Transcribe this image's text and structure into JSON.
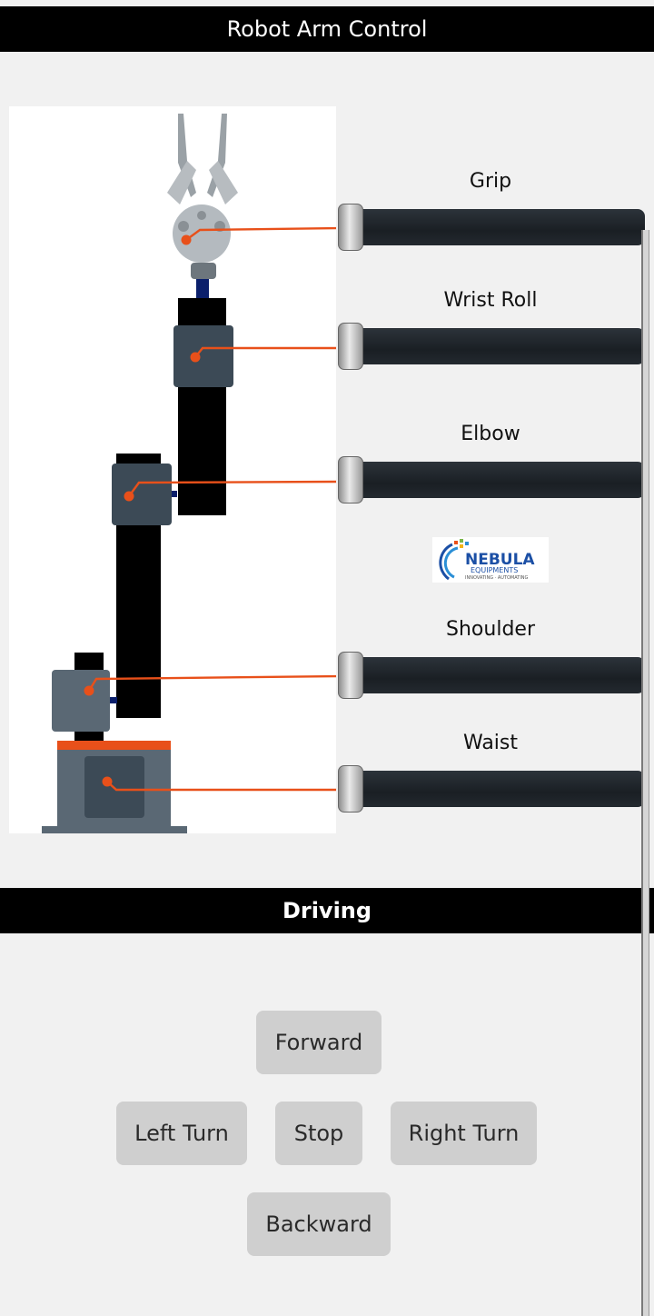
{
  "header": {
    "title": "Robot Arm Control"
  },
  "sliders": [
    {
      "id": "grip",
      "label": "Grip",
      "value": 0
    },
    {
      "id": "wrist-roll",
      "label": "Wrist Roll",
      "value": 0
    },
    {
      "id": "elbow",
      "label": "Elbow",
      "value": 0
    },
    {
      "id": "shoulder",
      "label": "Shoulder",
      "value": 0
    },
    {
      "id": "waist",
      "label": "Waist",
      "value": 0
    }
  ],
  "logo": {
    "name": "NEBULA",
    "sub": "EQUIPMENTS",
    "tagline": "INNOVATING · AUTOMATING"
  },
  "driving": {
    "title": "Driving",
    "forward": "Forward",
    "left": "Left Turn",
    "stop": "Stop",
    "right": "Right Turn",
    "backward": "Backward"
  },
  "colors": {
    "accent": "#e8501a",
    "bar": "#000000",
    "track": "#1f252b",
    "button": "#cfcfcf"
  }
}
